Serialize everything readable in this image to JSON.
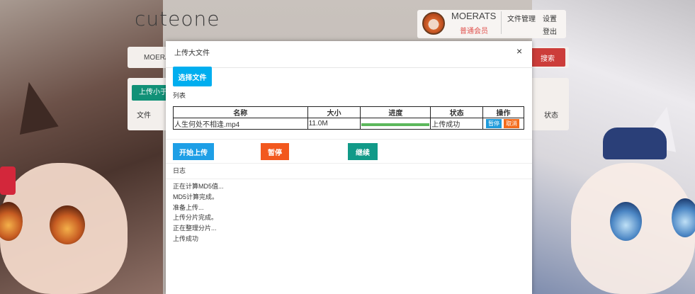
{
  "header": {
    "logo": "cuteone",
    "username": "MOERATS",
    "role": "普通会员",
    "nav_files": "文件管理",
    "nav_settings": "设置",
    "nav_logout": "登出"
  },
  "background_page": {
    "breadcrumb": "MOERA",
    "search_button": "搜索",
    "upload_small_button": "上传小于",
    "col_file": "文件",
    "col_status": "状态"
  },
  "modal": {
    "title": "上传大文件",
    "choose_button": "选择文件",
    "list_label": "列表",
    "table_headers": [
      "名称",
      "大小",
      "进度",
      "状态",
      "操作"
    ],
    "files": [
      {
        "name": "人生何处不相逢.mp4",
        "size": "11.0M",
        "progress": 1.0,
        "status": "上传成功",
        "pause_label": "暂停",
        "cancel_label": "取消"
      }
    ],
    "start_button": "开始上传",
    "pause_button": "暂停",
    "continue_button": "继续",
    "log_label": "日志",
    "log_lines": [
      "正在计算MD5值...",
      "MD5计算完成。",
      "准备上传...",
      "上传分片完成。",
      "正在整理分片...",
      "上传成功"
    ]
  },
  "colors": {
    "search_red": "#cc3d3a",
    "upload_green": "#119177",
    "choose_blue": "#00aeef",
    "start_blue": "#1e9fe6",
    "pause_orange": "#f2581e",
    "continue_teal": "#119a88",
    "progress_green": "#5cb85c"
  }
}
